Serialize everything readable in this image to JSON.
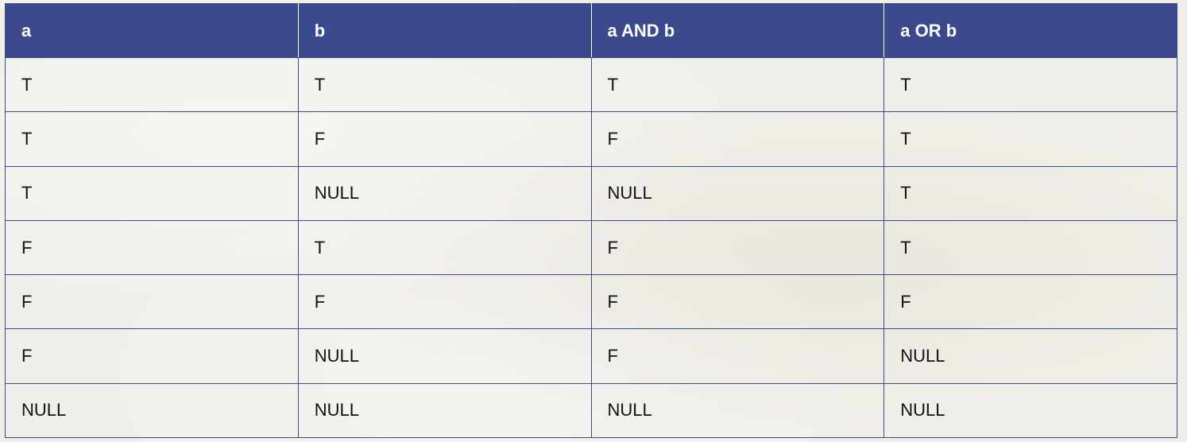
{
  "table": {
    "headers": [
      "a",
      "b",
      "a AND b",
      "a OR b"
    ],
    "rows": [
      [
        "T",
        "T",
        "T",
        "T"
      ],
      [
        "T",
        "F",
        "F",
        "T"
      ],
      [
        "T",
        "NULL",
        "NULL",
        "T"
      ],
      [
        "F",
        "T",
        "F",
        "T"
      ],
      [
        "F",
        "F",
        "F",
        "F"
      ],
      [
        "F",
        "NULL",
        "F",
        "NULL"
      ],
      [
        "NULL",
        "NULL",
        "NULL",
        "NULL"
      ]
    ]
  },
  "colors": {
    "header_bg": "#3a4a8c",
    "border": "#3a4a8c",
    "page_bg": "#f1efe9"
  }
}
